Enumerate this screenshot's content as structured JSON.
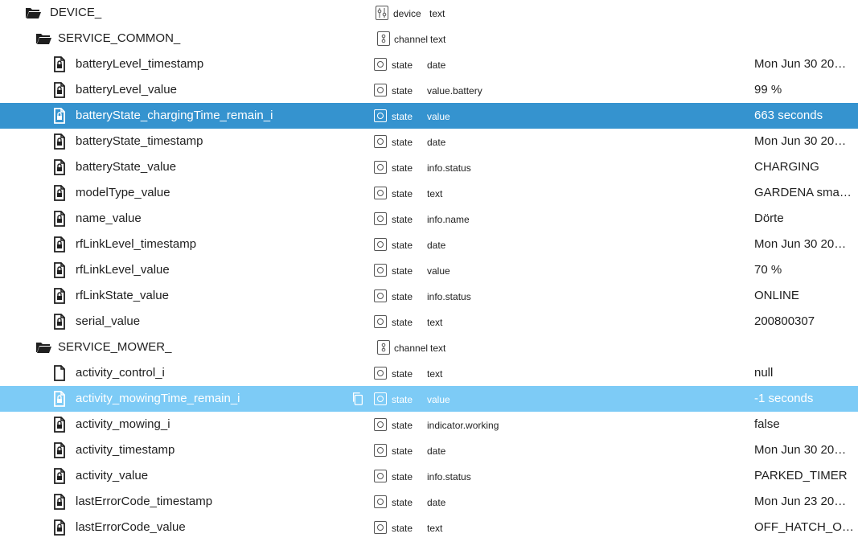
{
  "tree": {
    "device": {
      "name": "DEVICE_",
      "type": "device",
      "role": "text"
    },
    "channels": [
      {
        "name": "SERVICE_COMMON_",
        "type": "channel",
        "role": "text",
        "states": [
          {
            "name": "batteryLevel_timestamp",
            "type": "state",
            "role": "date",
            "value": "Mon Jun 30 20…"
          },
          {
            "name": "batteryLevel_value",
            "type": "state",
            "role": "value.battery",
            "value": "99 %"
          },
          {
            "name": "batteryState_chargingTime_remain_i",
            "type": "state",
            "role": "value",
            "value": "663 seconds",
            "selected": true
          },
          {
            "name": "batteryState_timestamp",
            "type": "state",
            "role": "date",
            "value": "Mon Jun 30 20…"
          },
          {
            "name": "batteryState_value",
            "type": "state",
            "role": "info.status",
            "value": "CHARGING"
          },
          {
            "name": "modelType_value",
            "type": "state",
            "role": "text",
            "value": "GARDENA sma…"
          },
          {
            "name": "name_value",
            "type": "state",
            "role": "info.name",
            "value": "Dörte"
          },
          {
            "name": "rfLinkLevel_timestamp",
            "type": "state",
            "role": "date",
            "value": "Mon Jun 30 20…"
          },
          {
            "name": "rfLinkLevel_value",
            "type": "state",
            "role": "value",
            "value": "70 %"
          },
          {
            "name": "rfLinkState_value",
            "type": "state",
            "role": "info.status",
            "value": "ONLINE"
          },
          {
            "name": "serial_value",
            "type": "state",
            "role": "text",
            "value": "200800307"
          }
        ]
      },
      {
        "name": "SERVICE_MOWER_",
        "type": "channel",
        "role": "text",
        "states": [
          {
            "name": "activity_control_i",
            "type": "state",
            "role": "text",
            "value": "null",
            "writable": true
          },
          {
            "name": "activity_mowingTime_remain_i",
            "type": "state",
            "role": "value",
            "value": "-1 seconds",
            "hovered": true
          },
          {
            "name": "activity_mowing_i",
            "type": "state",
            "role": "indicator.working",
            "value": "false"
          },
          {
            "name": "activity_timestamp",
            "type": "state",
            "role": "date",
            "value": "Mon Jun 30 20…"
          },
          {
            "name": "activity_value",
            "type": "state",
            "role": "info.status",
            "value": "PARKED_TIMER"
          },
          {
            "name": "lastErrorCode_timestamp",
            "type": "state",
            "role": "date",
            "value": "Mon Jun 23 20…"
          },
          {
            "name": "lastErrorCode_value",
            "type": "state",
            "role": "text",
            "value": "OFF_HATCH_O…"
          }
        ]
      }
    ]
  },
  "icons": {
    "device": "folder-open-icon",
    "channel": "folder-open-icon",
    "state": "file-lock-icon",
    "writable_state": "file-icon",
    "type_device": "device-sliders-icon",
    "type_channel": "channel-icon",
    "type_state": "state-circle-icon",
    "copy": "copy-icon"
  },
  "colors": {
    "selected_row": "#3593cf",
    "hovered_row": "#7dcbf6",
    "text": "#1f1f1f"
  }
}
